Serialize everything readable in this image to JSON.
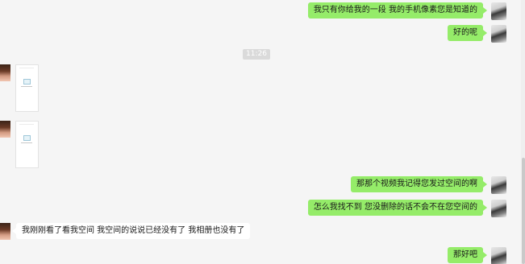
{
  "timestamp": "11:26",
  "messages": {
    "m1": "我只有你给我的一段   我的手机像素您是知道的",
    "m2": "好的呢",
    "m3": "那那个视频我记得您发过空间的啊",
    "m4": "怎么我找不到  您没删除的话不会不在您空间的",
    "m5": "我刚刚看了看我空间    我空间的说说已经没有了   我相册也没有了",
    "m6": "那好吧"
  },
  "colors": {
    "background": "#f5f5f5",
    "outgoing_bubble": "#95ec69",
    "incoming_bubble": "#ffffff",
    "timestamp_bg": "#dadada"
  },
  "icons": {
    "outgoing_avatar": "anime-avatar-icon",
    "incoming_avatar": "photo-avatar-icon",
    "image_placeholder": "image-thumbnail-icon"
  }
}
